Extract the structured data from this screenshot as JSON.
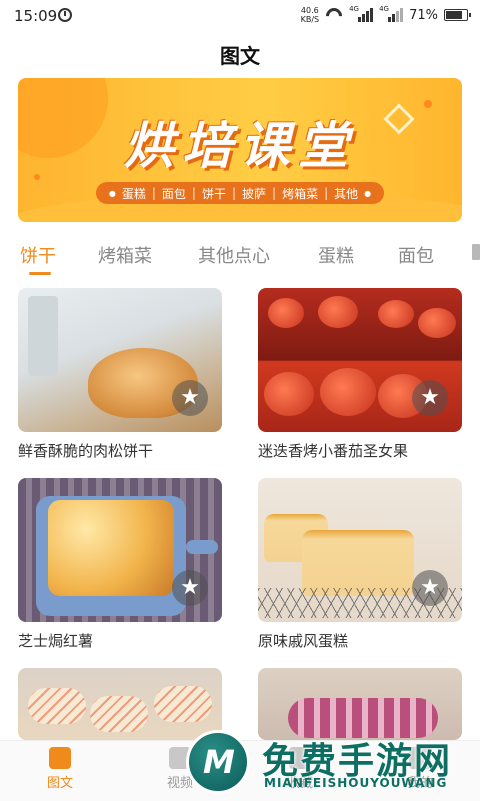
{
  "status_bar": {
    "time": "15:09",
    "net_speed_value": "40.6",
    "net_speed_unit": "KB/S",
    "network_tag_1": "4G",
    "network_tag_2": "4G",
    "battery": "71%"
  },
  "header": {
    "title": "图文"
  },
  "banner": {
    "title": "烘培课堂",
    "categories": [
      "蛋糕",
      "面包",
      "饼干",
      "披萨",
      "烤箱菜",
      "其他"
    ]
  },
  "tabs": [
    "饼干",
    "烤箱菜",
    "其他点心",
    "蛋糕",
    "面包"
  ],
  "active_tab": "饼干",
  "cards": [
    {
      "title": "鲜香酥脆的肉松饼干"
    },
    {
      "title": "迷迭香烤小番茄圣女果"
    },
    {
      "title": "芝士焗红薯"
    },
    {
      "title": "原味戚风蛋糕"
    },
    {
      "title": ""
    },
    {
      "title": ""
    }
  ],
  "bottom_nav": {
    "items": [
      "图文",
      "视频",
      "收藏",
      "我的"
    ],
    "active": "图文"
  },
  "watermark": {
    "title": "免费手游网",
    "subtitle": "MIANFEISHOUYOUWANG"
  },
  "colors": {
    "accent": "#f08a1c",
    "banner": "#ffc23a",
    "watermark": "#0d6f63"
  },
  "icons": [
    "alarm-icon",
    "wifi-icon",
    "signal-icon",
    "battery-icon",
    "star-icon",
    "book-icon",
    "video-icon"
  ]
}
